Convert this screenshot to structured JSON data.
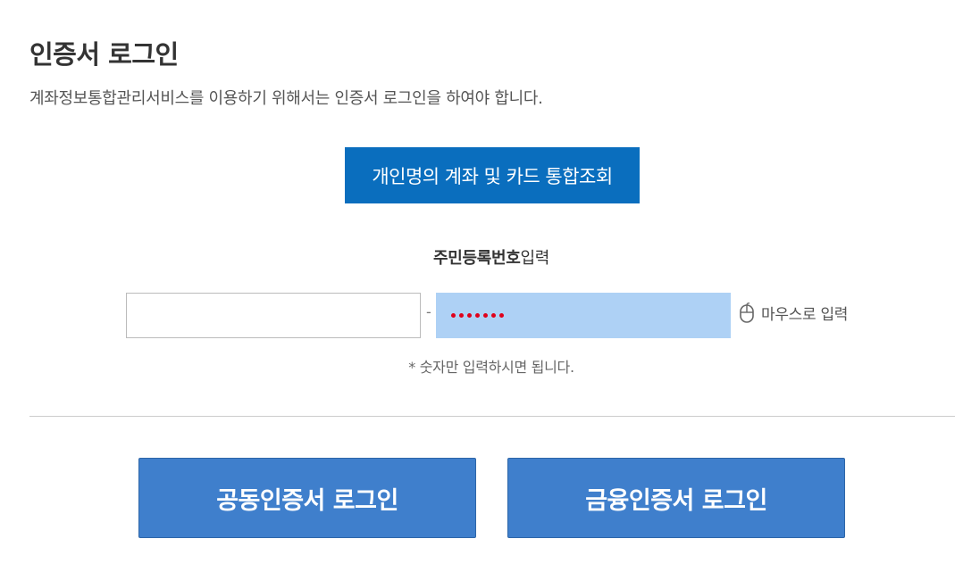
{
  "header": {
    "title": "인증서 로그인",
    "description": "계좌정보통합관리서비스를 이용하기 위해서는 인증서 로그인을 하여야 합니다."
  },
  "inquiry_button": {
    "label": "개인명의 계좌 및 카드 통합조회"
  },
  "ssn": {
    "label_bold": "주민등록번호",
    "label_rest": "입력",
    "front_value": "",
    "separator": "-",
    "back_masked_length": 7,
    "mask_color": "#e0001a",
    "mouse_input_label": "마우스로 입력",
    "mouse_input_icon": "mouse-icon",
    "note": "* 숫자만 입력하시면 됩니다."
  },
  "login": {
    "joint_label": "공동인증서 로그인",
    "finance_label": "금융인증서 로그인"
  },
  "colors": {
    "primary": "#0a6ebe",
    "login_button": "#3f7fcc",
    "masked_field": "#aed1f5"
  }
}
